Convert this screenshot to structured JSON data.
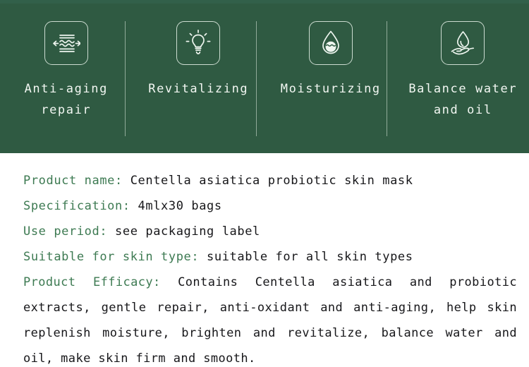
{
  "colors": {
    "banner_bg": "#2f5a42",
    "banner_top_strip": "#32604a",
    "icon_stroke": "#eef5ef",
    "divider": "#e2eee4",
    "label_text": "#f2f7f2",
    "spec_label": "#3d7a52",
    "spec_value": "#17171a",
    "page_bg": "#ffffff"
  },
  "banner": {
    "features": [
      {
        "icon": "skin-elasticity-waves-icon",
        "label": "Anti-aging\nrepair"
      },
      {
        "icon": "lightbulb-icon",
        "label": "Revitalizing"
      },
      {
        "icon": "water-drop-icon",
        "label": "Moisturizing"
      },
      {
        "icon": "drop-on-hand-icon",
        "label": "Balance water\nand oil"
      }
    ]
  },
  "details": {
    "specs": [
      {
        "label": "Product name:",
        "value": " Centella asiatica probiotic skin mask"
      },
      {
        "label": "Specification:",
        "value": " 4mlx30 bags"
      },
      {
        "label": "Use period:",
        "value": " see packaging label"
      },
      {
        "label": "Suitable for skin type:",
        "value": " suitable for all skin types"
      }
    ],
    "efficacy": {
      "label": "Product Efficacy:",
      "value": " Contains Centella asiatica and probiotic extracts, gentle repair, anti-oxidant and anti-aging, help skin replenish moisture, brighten and revitalize, balance water and oil, make skin firm and smooth."
    }
  }
}
